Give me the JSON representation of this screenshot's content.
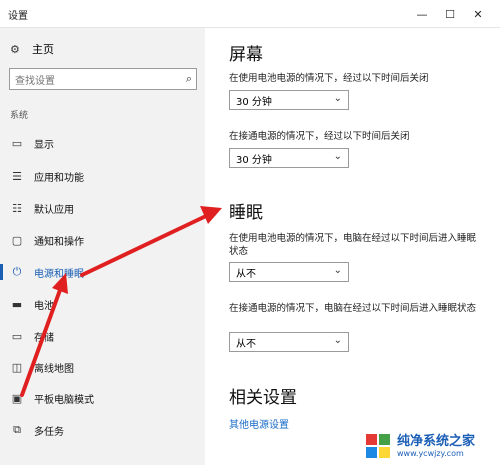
{
  "window": {
    "title": "设置",
    "min_glyph": "—",
    "max_glyph": "☐",
    "close_glyph": "✕"
  },
  "sidebar": {
    "home_label": "主页",
    "search_placeholder": "查找设置",
    "section": "系统",
    "items": [
      {
        "label": "显示",
        "icon": "monitor-icon"
      },
      {
        "label": "应用和功能",
        "icon": "list-icon"
      },
      {
        "label": "默认应用",
        "icon": "default-apps-icon"
      },
      {
        "label": "通知和操作",
        "icon": "notification-icon"
      },
      {
        "label": "电源和睡眠",
        "icon": "power-icon",
        "active": true
      },
      {
        "label": "电池",
        "icon": "battery-icon"
      },
      {
        "label": "存储",
        "icon": "storage-icon"
      },
      {
        "label": "离线地图",
        "icon": "map-icon"
      },
      {
        "label": "平板电脑模式",
        "icon": "tablet-icon"
      },
      {
        "label": "多任务",
        "icon": "multitask-icon"
      }
    ]
  },
  "main": {
    "screen": {
      "heading": "屏幕",
      "battery_desc": "在使用电池电源的情况下，经过以下时间后关闭",
      "battery_value": "30 分钟",
      "plugged_desc": "在接通电源的情况下，经过以下时间后关闭",
      "plugged_value": "30 分钟"
    },
    "sleep": {
      "heading": "睡眠",
      "battery_desc": "在使用电池电源的情况下，电脑在经过以下时间后进入睡眠状态",
      "battery_value": "从不",
      "plugged_desc": "在接通电源的情况下，电脑在经过以下时间后进入睡眠状态",
      "plugged_value": "从不"
    },
    "related": {
      "heading": "相关设置",
      "link": "其他电源设置"
    }
  },
  "watermark": {
    "name": "纯净系统之家",
    "url": "www.ycwjzy.com"
  },
  "colors": {
    "accent": "#1a5fb4",
    "arrow": "#e02020",
    "sidebar_bg": "#f2f2f2"
  }
}
